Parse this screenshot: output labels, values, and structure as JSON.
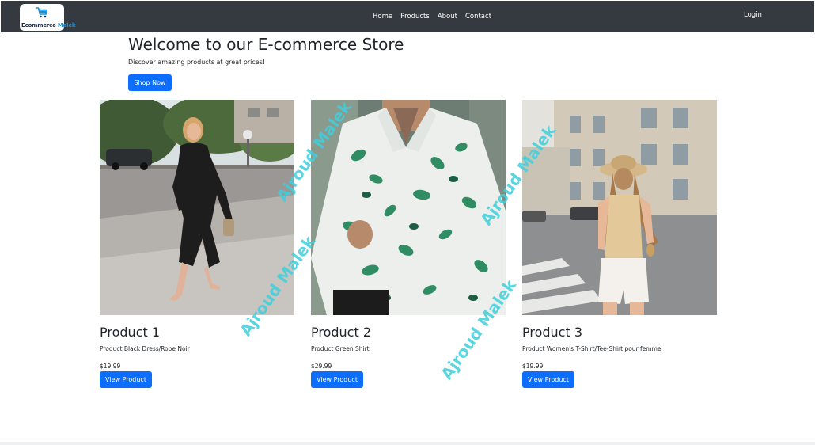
{
  "navbar": {
    "brand": {
      "text_main": "Ecommerce",
      "text_accent": "Malek",
      "icon": "shopping-cart-icon"
    },
    "links": [
      "Home",
      "Products",
      "About",
      "Contact"
    ],
    "login": "Login"
  },
  "hero": {
    "title": "Welcome to our E-commerce Store",
    "subtitle": "Discover amazing products at great prices!",
    "button": "Shop Now"
  },
  "products": [
    {
      "name": "Product 1",
      "description": "Product Black Dress/Robe Noir",
      "price": "$19.99",
      "button": "View Product",
      "image": "woman-black-dress-photo"
    },
    {
      "name": "Product 2",
      "description": "Product Green Shirt",
      "price": "$29.99",
      "button": "View Product",
      "image": "man-green-floral-shirt-photo"
    },
    {
      "name": "Product 3",
      "description": "Product Women's T-Shirt/Tee-Shirt pour femme",
      "price": "$19.99",
      "button": "View Product",
      "image": "woman-tank-top-shorts-photo"
    }
  ],
  "watermark": "Ajroud Malek",
  "colors": {
    "navbar": "#343a40",
    "primary": "#0d6efd",
    "watermark": "#3fd0dc"
  }
}
